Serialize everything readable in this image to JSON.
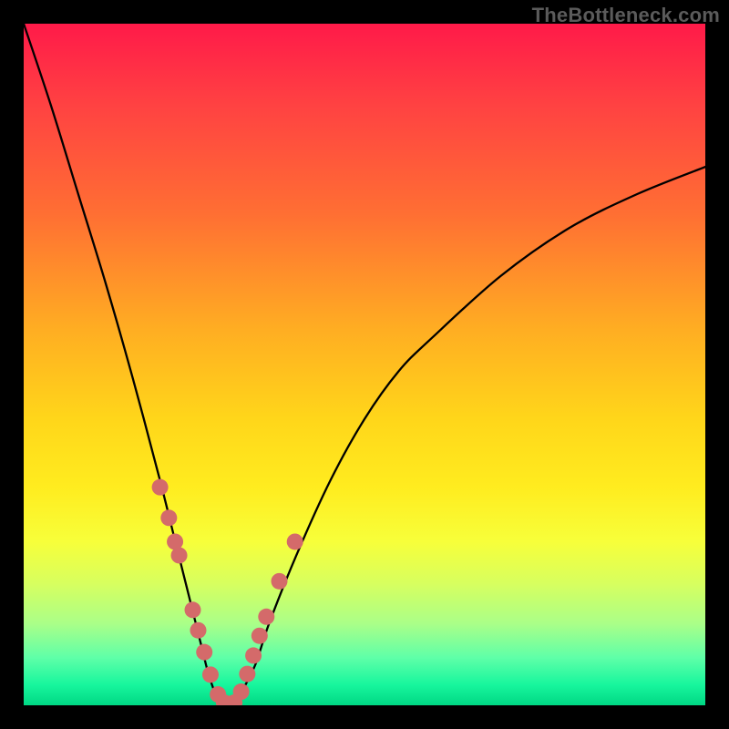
{
  "watermark": "TheBottleneck.com",
  "chart_data": {
    "type": "line",
    "title": "",
    "xlabel": "",
    "ylabel": "",
    "xlim": [
      0,
      100
    ],
    "ylim": [
      0,
      100
    ],
    "series": [
      {
        "name": "bottleneck-curve",
        "x": [
          0,
          4,
          8,
          12,
          16,
          20,
          22,
          24,
          26,
          27,
          28,
          29,
          30,
          31,
          32,
          34,
          36,
          40,
          45,
          50,
          55,
          60,
          70,
          80,
          90,
          100
        ],
        "values": [
          100,
          88,
          75,
          62,
          48,
          33,
          25,
          17,
          9,
          5,
          2,
          0,
          0,
          0,
          2,
          6,
          12,
          22,
          33,
          42,
          49,
          54,
          63,
          70,
          75,
          79
        ]
      }
    ],
    "markers": {
      "name": "highlighted-points",
      "color": "#d46a6a",
      "x": [
        20.0,
        21.3,
        22.2,
        22.8,
        24.8,
        25.6,
        26.5,
        27.4,
        28.5,
        29.4,
        30.1,
        30.9,
        31.9,
        32.8,
        33.7,
        34.6,
        35.6,
        37.5,
        39.8
      ],
      "values": [
        32.0,
        27.5,
        24.0,
        22.0,
        14.0,
        11.0,
        7.8,
        4.5,
        1.6,
        0.4,
        0.2,
        0.4,
        2.0,
        4.6,
        7.3,
        10.2,
        13.0,
        18.2,
        24.0
      ]
    },
    "background_gradient": {
      "top": "#ff1a49",
      "bottom": "#00d884"
    }
  }
}
